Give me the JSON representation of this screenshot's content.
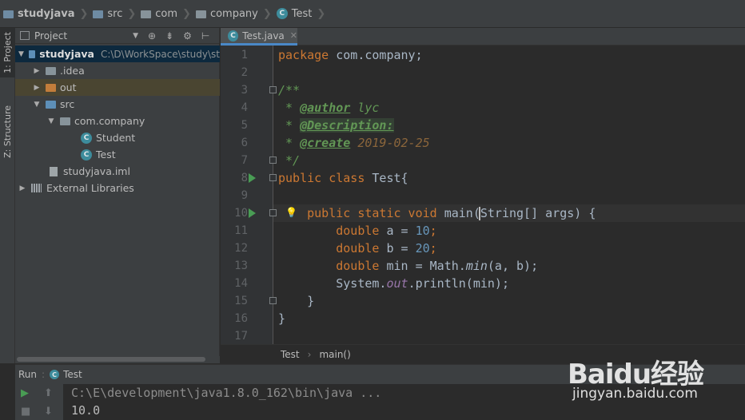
{
  "navbar": {
    "crumbs": [
      "studyjava",
      "src",
      "com",
      "company",
      "Test"
    ]
  },
  "left_stripe": {
    "tab_project": "1: Project",
    "tab_structure": "Z: Structure"
  },
  "project_panel": {
    "title": "Project",
    "tree": [
      {
        "label": "studyjava",
        "path": "C:\\D\\WorkSpace\\study\\st",
        "type": "module"
      },
      {
        "label": ".idea",
        "type": "folder"
      },
      {
        "label": "out",
        "type": "folder-excluded"
      },
      {
        "label": "src",
        "type": "source-folder"
      },
      {
        "label": "com.company",
        "type": "package"
      },
      {
        "label": "Student",
        "type": "class"
      },
      {
        "label": "Test",
        "type": "class"
      },
      {
        "label": "studyjava.iml",
        "type": "file"
      },
      {
        "label": "External Libraries",
        "type": "libraries"
      }
    ]
  },
  "editor": {
    "tab_label": "Test.java",
    "line_numbers": [
      "1",
      "2",
      "3",
      "4",
      "5",
      "6",
      "7",
      "8",
      "9",
      "10",
      "11",
      "12",
      "13",
      "14",
      "15",
      "16",
      "17"
    ],
    "code": {
      "l1_kw": "package",
      "l1_rest": " com.company;",
      "l3": "/**",
      "l4_star": " * ",
      "l4_tag": "@author",
      "l4_val": " lyc",
      "l5_star": " * ",
      "l5_tag": "@Description:",
      "l6_star": " * ",
      "l6_tag": "@create",
      "l6_val": " 2019-02-25",
      "l7": " */",
      "l8_kw": "public class",
      "l8_rest": " Test{",
      "l10_indent": "    ",
      "l10_kw": "public static void",
      "l10_rest": " main(String[] args) {",
      "l11_indent": "        ",
      "l11_kw": "double",
      "l11_mid": " a = ",
      "l11_num": "10",
      "l11_end": ";",
      "l12_indent": "        ",
      "l12_kw": "double",
      "l12_mid": " b = ",
      "l12_num": "20",
      "l12_end": ";",
      "l13_indent": "        ",
      "l13_kw": "double",
      "l13_mid": " min = Math.",
      "l13_it": "min",
      "l13_end": "(a, b);",
      "l14_indent": "        ",
      "l14_pre": "System.",
      "l14_fld": "out",
      "l14_end": ".println(min);",
      "l15": "    }",
      "l16": "}"
    },
    "breadcrumb": [
      "Test",
      "main()"
    ]
  },
  "run_panel": {
    "title_run": "Run",
    "title_config": "Test",
    "console": [
      "C:\\E\\development\\java1.8.0_162\\bin\\java ...",
      "10.0"
    ]
  },
  "watermark": {
    "brand": "Baidu经验",
    "url": "jingyan.baidu.com"
  },
  "colors": {
    "keyword": "#cc7832",
    "comment": "#629755",
    "number": "#6897bb",
    "field": "#9876aa",
    "run_green": "#499c54",
    "tab_underline": "#4a88c7"
  }
}
